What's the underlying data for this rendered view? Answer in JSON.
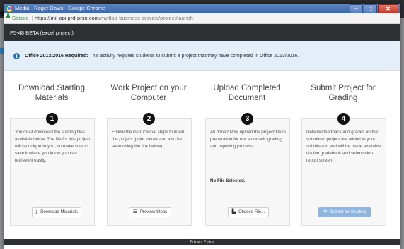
{
  "browser": {
    "window_title": "Media - Roger Davis - Google Chrome",
    "secure_label": "Secure",
    "url_host": "https://mil-api.prd-prsn.com",
    "url_path": "/myitlab-business-service/project/launch",
    "window_controls": [
      "minimize-icon",
      "maximize-icon",
      "close-icon"
    ]
  },
  "app": {
    "title": "P5-48 BETA (excel project)"
  },
  "alert": {
    "icon": "info-icon",
    "bold": "Office 2013/2016 Required:",
    "text": " This activity requires students to submit a project that they have completed in Office 2013/2016."
  },
  "steps": [
    {
      "number": "1",
      "title": "Download Starting Materials",
      "description": "You must download the starting files available below. The file for this project will be unique to you, so make sure to save it where you know you can retrieve it easily.",
      "button_label": "Download Materials",
      "button_icon": "download-icon"
    },
    {
      "number": "2",
      "title": "Work Project on your Computer",
      "description": "Follow the instructional steps to finish the project (point values can also be seen using the link below).",
      "button_label": "Preview Steps",
      "button_icon": "list-icon"
    },
    {
      "number": "3",
      "title": "Upload Completed Document",
      "description": "All done? Now upload the project file in preparation for our automatic grading and reporting process.",
      "status": "No File Selected.",
      "button_label": "Choose File...",
      "button_icon": "file-icon"
    },
    {
      "number": "4",
      "title": "Submit Project for Grading",
      "description": "Detailed feedback and grades on the submitted project are added to your submission and will be made available via the gradebook and submission report screen.",
      "button_label": "Submit for Grading",
      "button_icon": "refresh-icon"
    }
  ],
  "footer": {
    "privacy": "Privacy Policy"
  },
  "colors": {
    "appbar": "#2d2f33",
    "alert_bg": "#e3eef8",
    "info_icon": "#2b6fb0",
    "submit_button": "#8fb5de"
  }
}
